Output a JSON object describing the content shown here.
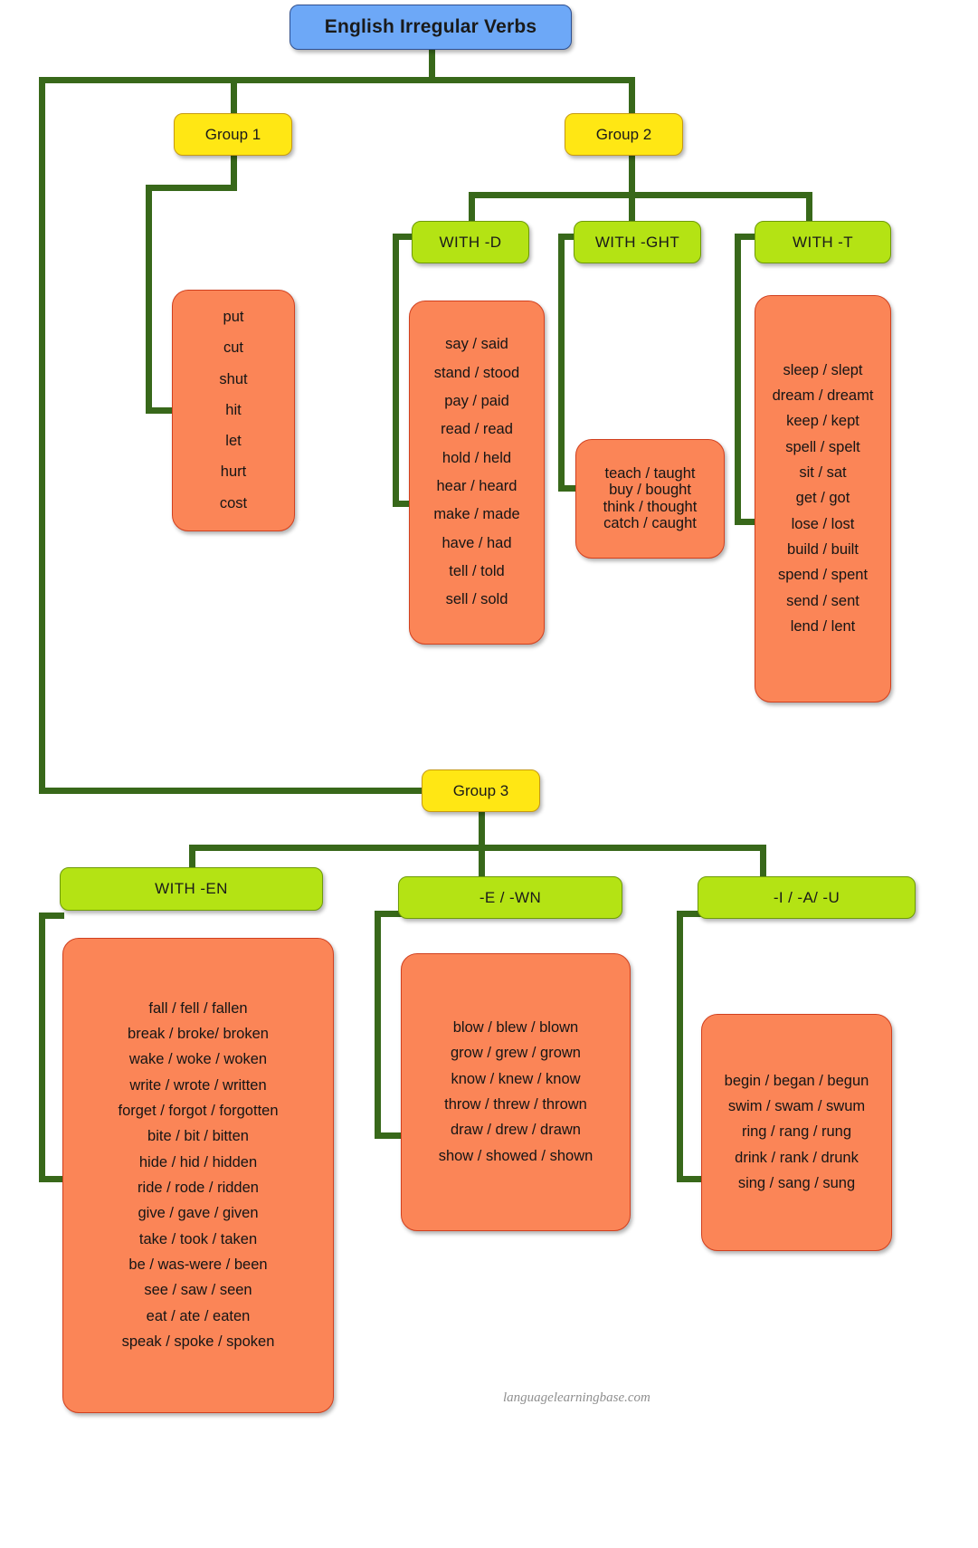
{
  "title": "English Irregular Verbs",
  "footer": "languagelearningbase.com",
  "colors": {
    "root": "#6DA8F7",
    "group": "#FFE714",
    "subcategory": "#B4E314",
    "verb_card": "#FB8557",
    "connector": "#38681A"
  },
  "groups": [
    {
      "label": "Group 1",
      "subcategories": [
        {
          "label": "",
          "verbs": [
            "put",
            "cut",
            "shut",
            "hit",
            "let",
            "hurt",
            "cost"
          ]
        }
      ]
    },
    {
      "label": "Group 2",
      "subcategories": [
        {
          "label": "WITH -D",
          "verbs": [
            "say / said",
            "stand / stood",
            "pay / paid",
            "read / read",
            "hold / held",
            "hear / heard",
            "make / made",
            "have / had",
            "tell / told",
            "sell / sold"
          ]
        },
        {
          "label": "WITH -GHT",
          "verbs": [
            "teach / taught",
            "buy / bought",
            "think / thought",
            "catch / caught"
          ]
        },
        {
          "label": "WITH -T",
          "verbs": [
            "sleep / slept",
            "dream / dreamt",
            "keep / kept",
            "spell / spelt",
            "sit / sat",
            "get / got",
            "lose / lost",
            "build / built",
            "spend / spent",
            "send / sent",
            "lend / lent"
          ]
        }
      ]
    },
    {
      "label": "Group 3",
      "subcategories": [
        {
          "label": "WITH -EN",
          "verbs": [
            "fall / fell / fallen",
            "break / broke/ broken",
            "wake / woke / woken",
            "write / wrote / written",
            "forget / forgot / forgotten",
            "bite / bit / bitten",
            "hide / hid / hidden",
            "ride / rode / ridden",
            "give / gave / given",
            "take / took / taken",
            "be / was-were / been",
            "see / saw / seen",
            "eat / ate / eaten",
            "speak / spoke / spoken"
          ]
        },
        {
          "label": "-E / -WN",
          "verbs": [
            "blow / blew / blown",
            "grow / grew / grown",
            "know / knew / know",
            "throw / threw / thrown",
            "draw / drew / drawn",
            "show / showed / shown"
          ]
        },
        {
          "label": "-I / -A/ -U",
          "verbs": [
            "begin / began / begun",
            "swim / swam / swum",
            "ring / rang / rung",
            "drink / rank / drunk",
            "sing / sang / sung"
          ]
        }
      ]
    }
  ]
}
